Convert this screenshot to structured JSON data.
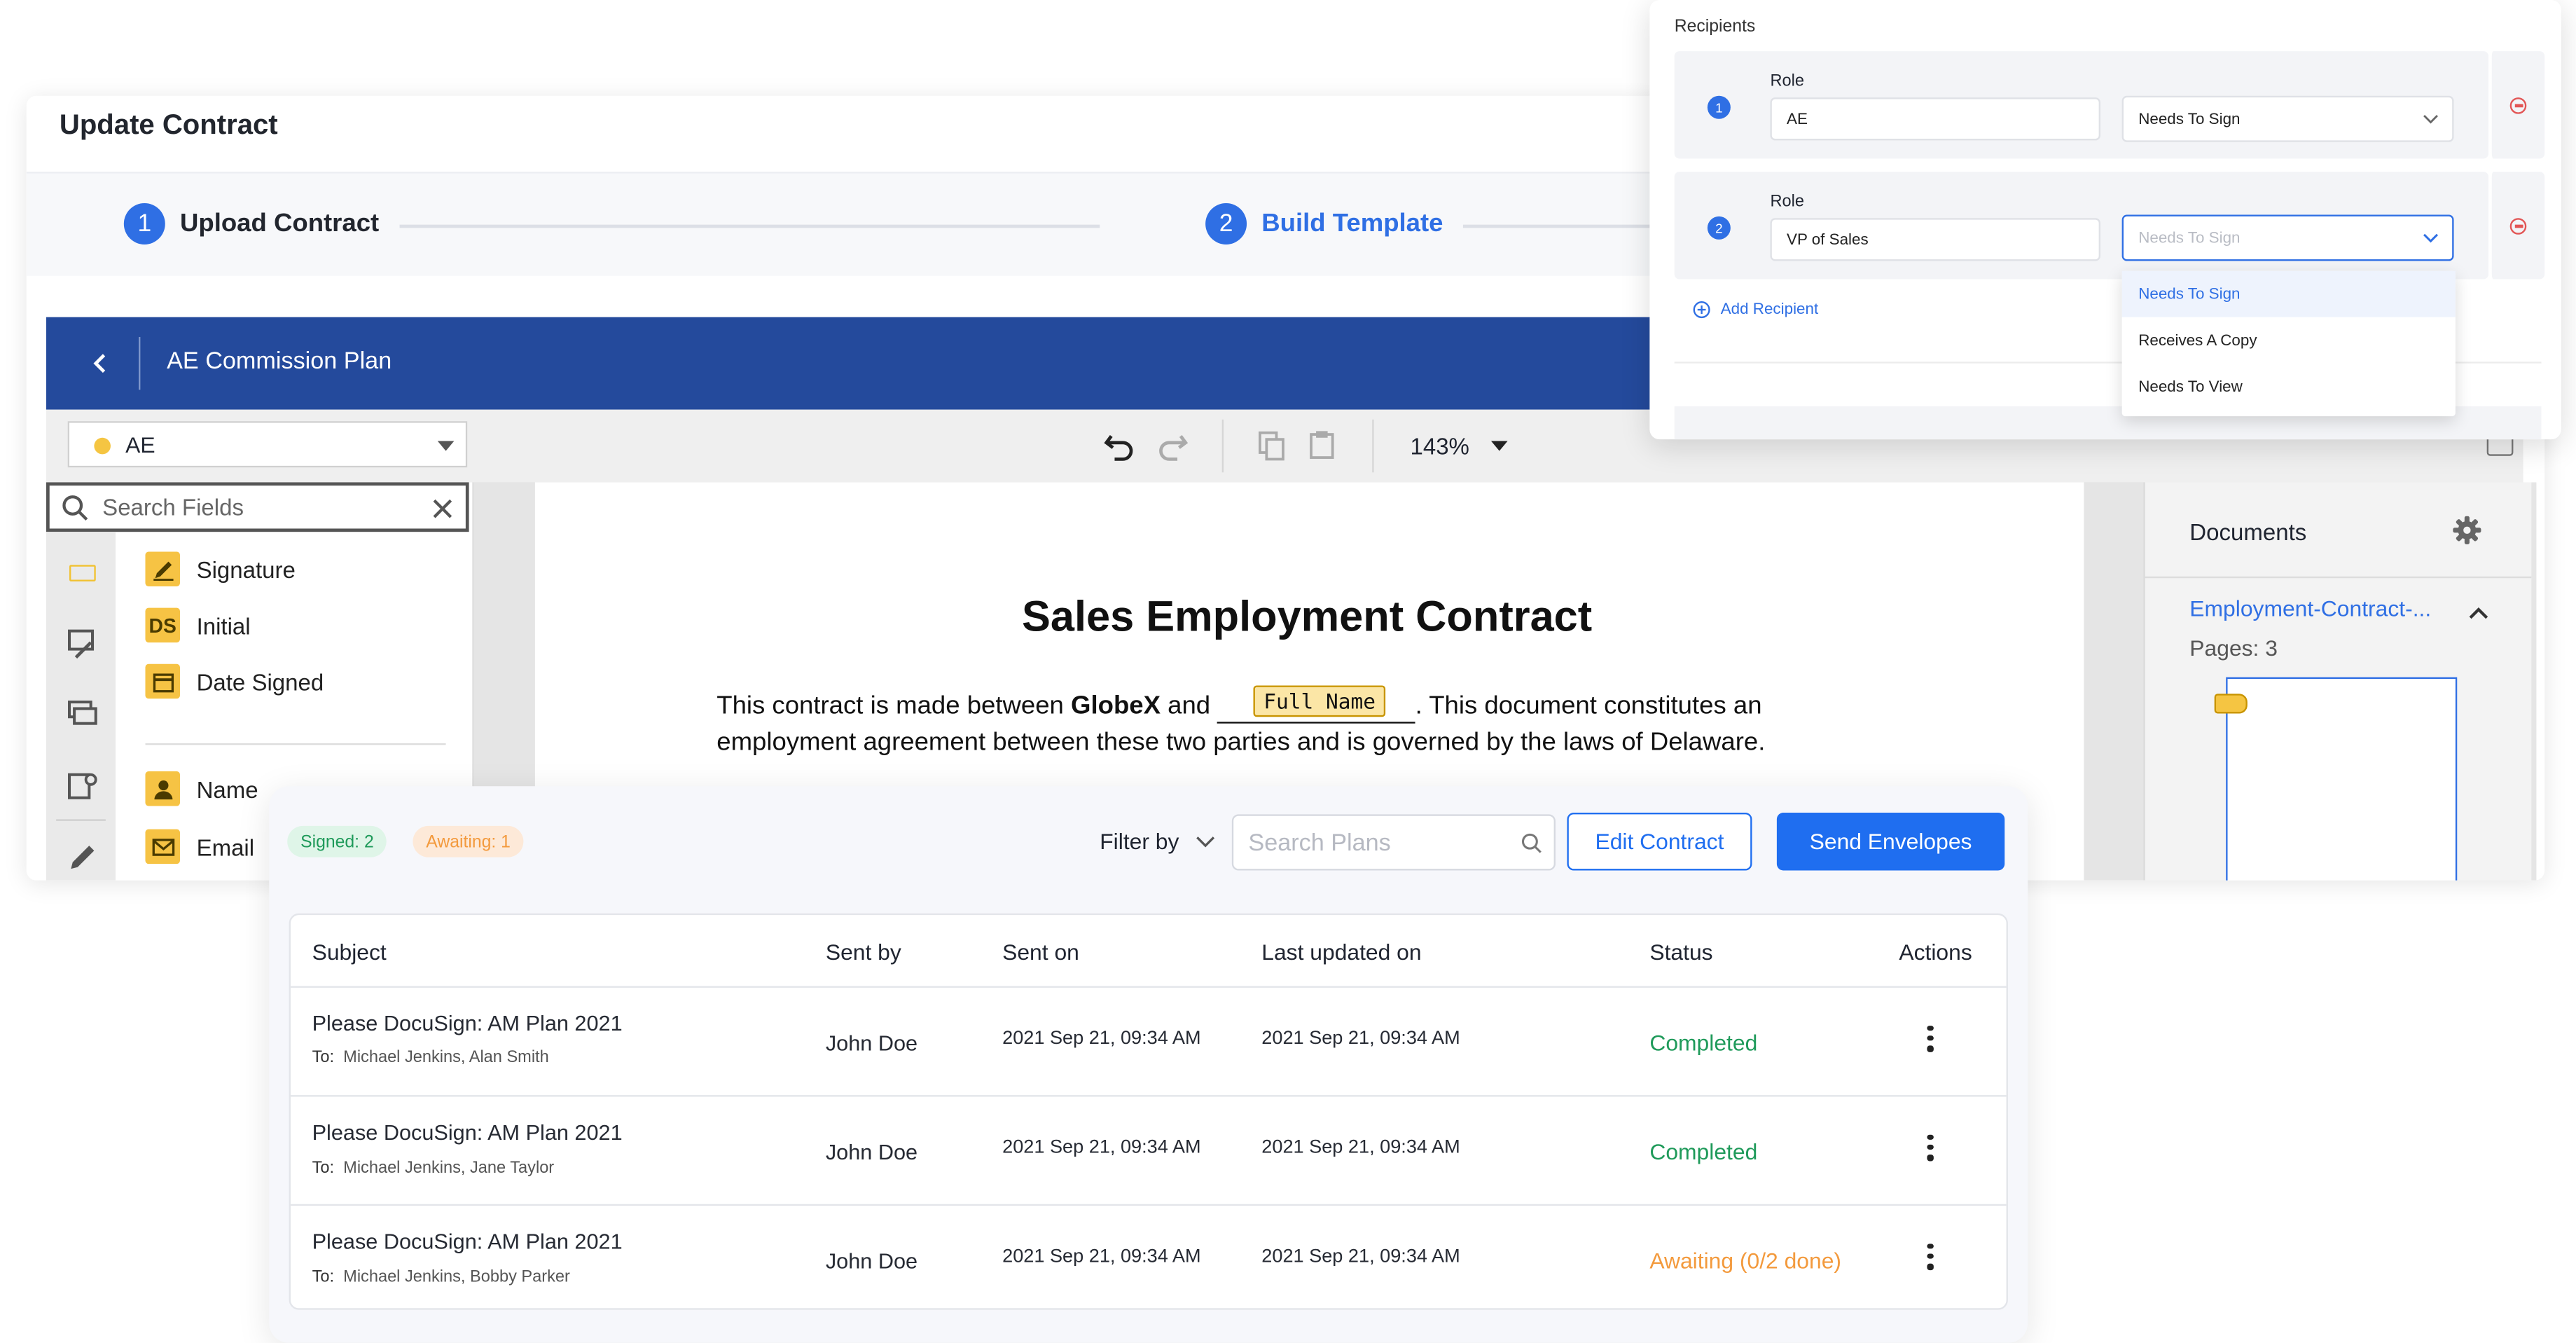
{
  "page": {
    "title": "Update Contract"
  },
  "stepper": {
    "steps": [
      {
        "number": "1",
        "label": "Upload Contract"
      },
      {
        "number": "2",
        "label": "Build Template"
      }
    ]
  },
  "header_bar": {
    "back_icon": "chevron-left-icon",
    "plan_name": "AE Commission Plan"
  },
  "role_select": {
    "value": "AE",
    "dot_color": "#f5c542"
  },
  "toolbar": {
    "zoom": "143%"
  },
  "search_fields": {
    "placeholder": "Search Fields"
  },
  "fields": [
    {
      "label": "Signature",
      "icon": "pen-icon"
    },
    {
      "label": "Initial",
      "icon": "DS"
    },
    {
      "label": "Date Signed",
      "icon": "calendar-icon"
    },
    {
      "label": "Name",
      "icon": "person-icon"
    },
    {
      "label": "Email",
      "icon": "envelope-icon"
    }
  ],
  "document": {
    "heading": "Sales Employment Contract",
    "p1_pre": "This contract is made between ",
    "p1_bold": "GlobeX",
    "p1_mid": " and ",
    "p1_field": "Full Name",
    "p1_post": ". This document constitutes an",
    "p2": "employment agreement between these two parties and is governed by the laws of Delaware."
  },
  "documents_panel": {
    "title": "Documents",
    "file": "Employment-Contract-...",
    "pages": "Pages: 3"
  },
  "recipients": {
    "title": "Recipients",
    "rows": [
      {
        "number": "1",
        "role_label": "Role",
        "role_value": "AE",
        "action": "Needs To Sign"
      },
      {
        "number": "2",
        "role_label": "Role",
        "role_value": "VP of Sales",
        "action_placeholder": "Needs To Sign"
      }
    ],
    "add_label": "Add Recipient",
    "options": [
      "Needs To Sign",
      "Receives A Copy",
      "Needs To View"
    ]
  },
  "envelopes": {
    "signed_pill": "Signed: 2",
    "awaiting_pill": "Awaiting: 1",
    "filter_label": "Filter by",
    "search_placeholder": "Search Plans",
    "edit_button": "Edit Contract",
    "send_button": "Send Envelopes",
    "columns": [
      "Subject",
      "Sent by",
      "Sent on",
      "Last updated on",
      "Status",
      "Actions"
    ],
    "rows": [
      {
        "subject": "Please DocuSign: AM Plan 2021",
        "to_label": "To:",
        "to": "Michael Jenkins, Alan Smith",
        "sent_by": "John Doe",
        "sent_on": "2021 Sep 21, 09:34 AM",
        "updated": "2021 Sep 21, 09:34 AM",
        "status": "Completed"
      },
      {
        "subject": "Please DocuSign: AM Plan 2021",
        "to_label": "To:",
        "to": "Michael Jenkins, Jane Taylor",
        "sent_by": "John Doe",
        "sent_on": "2021 Sep 21, 09:34 AM",
        "updated": "2021 Sep 21, 09:34 AM",
        "status": "Completed"
      },
      {
        "subject": "Please DocuSign: AM Plan 2021",
        "to_label": "To:",
        "to": "Michael Jenkins, Bobby Parker",
        "sent_by": "John Doe",
        "sent_on": "2021 Sep 21, 09:34 AM",
        "updated": "2021 Sep 21, 09:34 AM",
        "status": "Awaiting (0/2 done)"
      }
    ],
    "colors": {
      "completed": "#1f9a5a",
      "awaiting": "#f39a3d",
      "accent": "#1f6ef0"
    }
  }
}
